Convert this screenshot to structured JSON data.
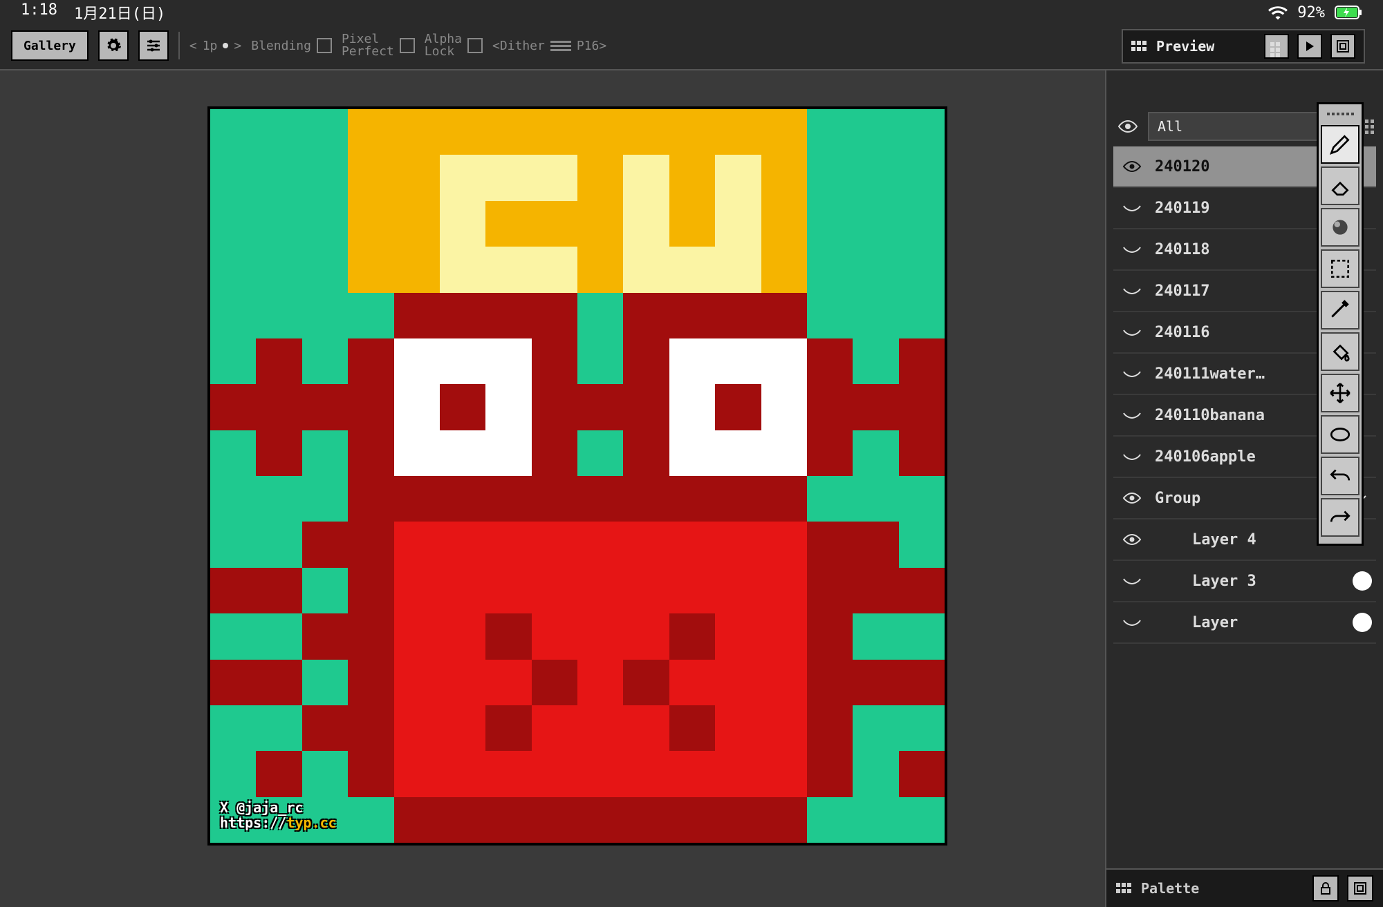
{
  "status": {
    "time": "1:18",
    "date": "1月21日(日)",
    "battery": "92%"
  },
  "toolbar": {
    "gallery": "Gallery",
    "brush_size": "1p",
    "blending": "Blending",
    "pixel_perfect_l1": "Pixel",
    "pixel_perfect_l2": "Perfect",
    "alpha_l1": "Alpha",
    "alpha_l2": "Lock",
    "dither": "<Dither",
    "dither_pattern": "P16>"
  },
  "preview": {
    "label": "Preview"
  },
  "layers": {
    "filter": "All",
    "items": [
      {
        "name": "240120",
        "visible": true,
        "selected": true,
        "is_group": false
      },
      {
        "name": "240119",
        "visible": false,
        "selected": false,
        "is_group": false
      },
      {
        "name": "240118",
        "visible": false,
        "selected": false,
        "is_group": false
      },
      {
        "name": "240117",
        "visible": false,
        "selected": false,
        "is_group": false
      },
      {
        "name": "240116",
        "visible": false,
        "selected": false,
        "is_group": false
      },
      {
        "name": "240111water…",
        "visible": false,
        "selected": false,
        "is_group": false
      },
      {
        "name": "240110banana",
        "visible": false,
        "selected": false,
        "is_group": false
      },
      {
        "name": "240106apple",
        "visible": false,
        "selected": false,
        "is_group": false
      },
      {
        "name": "Group",
        "visible": true,
        "selected": false,
        "is_group": true
      },
      {
        "name": "Layer 4",
        "visible": true,
        "selected": false,
        "child": true
      },
      {
        "name": "Layer 3",
        "visible": false,
        "selected": false,
        "child": true,
        "swatch": "#fff"
      },
      {
        "name": "Layer",
        "visible": false,
        "selected": false,
        "child": true,
        "swatch": "#fff"
      }
    ]
  },
  "palette": {
    "label": "Palette"
  },
  "watermark": {
    "line1": "X @jaja_rc",
    "line2_pre": "https://",
    "line2_hi": "typ.cc"
  },
  "tool_dock": {
    "items": [
      {
        "name": "pencil-icon",
        "active": true
      },
      {
        "name": "eraser-icon",
        "active": false
      },
      {
        "name": "sphere-icon",
        "active": false
      },
      {
        "name": "marquee-icon",
        "active": false
      },
      {
        "name": "eyedropper-icon",
        "active": false
      },
      {
        "name": "bucket-icon",
        "active": false
      },
      {
        "name": "move-icon",
        "active": false
      },
      {
        "name": "ellipse-icon",
        "active": false
      },
      {
        "name": "undo-icon",
        "active": false
      },
      {
        "name": "redo-icon",
        "active": false
      }
    ]
  },
  "pixel_art": {
    "colors": {
      "G": "#1fc98f",
      "O": "#f5b400",
      "C": "#fbf4a4",
      "D": "#a20d0d",
      "R": "#e61515",
      "W": "#ffffff"
    },
    "rows": [
      "GGGOOOOOOOOOOGGG",
      "GGGOOCCCOCOCOGGG",
      "GGGOOCOOOCOCOGGG",
      "GGGOOCCCOCCCOGGG",
      "GGGGDDDDGDDDDGGG",
      "GDGDWWWDGDWWWDGD",
      "DDDDWDWDDDWDWDDD",
      "GDGDWWWDGDWWWDGD",
      "GGGDDDDDDDDDDGGG",
      "GGDDRRRRRRRRRDDG",
      "DDGDRRRRRRRRRDDD",
      "GGDDRRDRRRDRRDGG",
      "DDGDRRRDRDRRRDDD",
      "GGDDRRDRRRDRRDGG",
      "GDGDRRRRRRRRRDGD",
      "GGGGDDDDDDDDDGGG"
    ]
  }
}
